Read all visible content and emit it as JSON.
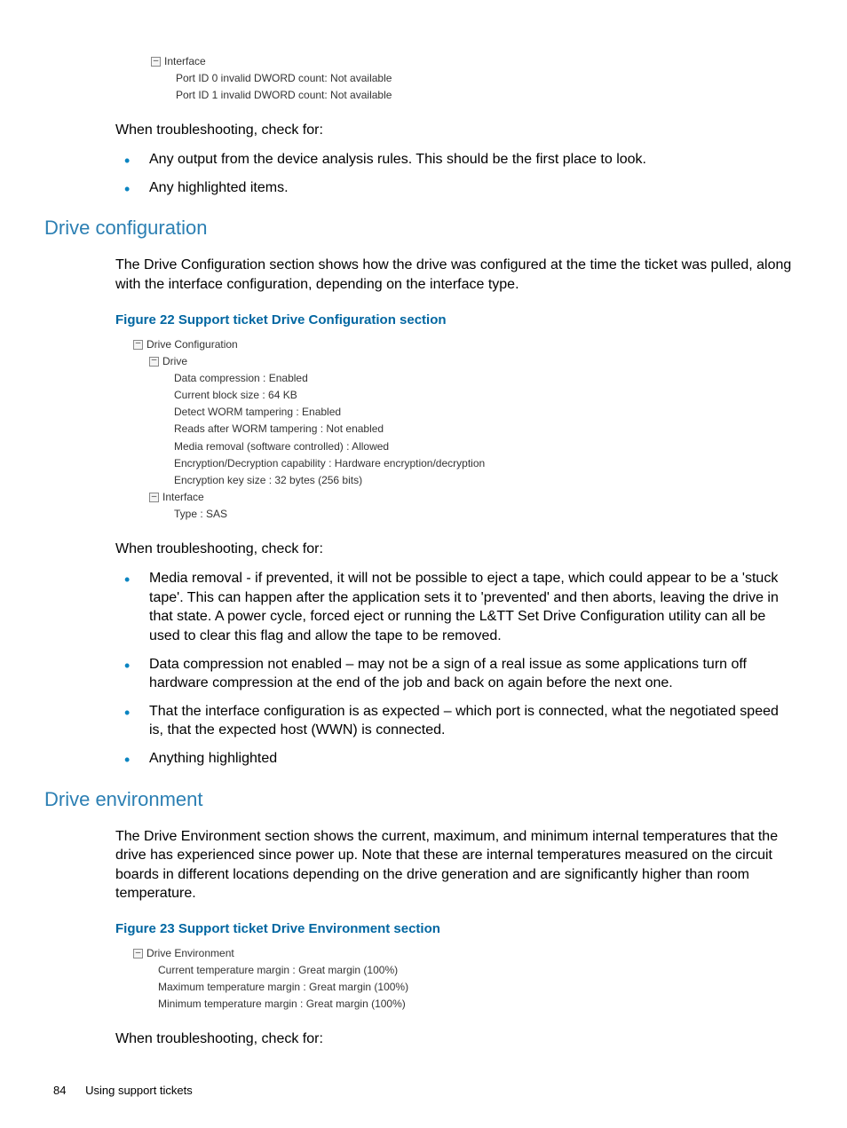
{
  "tree1": {
    "node": "Interface",
    "lines": [
      "Port ID 0 invalid DWORD count: Not available",
      "Port ID 1 invalid DWORD count: Not available"
    ]
  },
  "para1": "When troubleshooting, check for:",
  "bullets1": [
    "Any output from the device analysis rules. This should be the first place to look.",
    "Any highlighted items."
  ],
  "section1": {
    "title": "Drive configuration",
    "para": "The Drive Configuration section shows how the drive was configured at the time the ticket was pulled, along with the interface configuration, depending on the interface type.",
    "fig_caption": "Figure 22 Support ticket Drive Configuration section",
    "tree": {
      "root": "Drive Configuration",
      "drive_node": "Drive",
      "drive_leaves": [
        "Data compression : Enabled",
        "Current block size : 64 KB",
        "Detect WORM tampering : Enabled",
        "Reads after WORM tampering : Not enabled",
        "Media removal (software controlled) : Allowed",
        "Encryption/Decryption capability : Hardware encryption/decryption",
        "Encryption key size : 32 bytes (256 bits)"
      ],
      "iface_node": "Interface",
      "iface_leaves": [
        "Type : SAS"
      ]
    },
    "para2": "When troubleshooting, check for:",
    "bullets": [
      "Media removal - if prevented, it will not be possible to eject a tape, which could appear to be a 'stuck tape'. This can happen after the application sets it to 'prevented' and then aborts, leaving the drive in that state. A power cycle, forced eject or running the L&TT Set Drive Configuration utility can all be used to clear this flag and allow the tape to be removed.",
      "Data compression not enabled – may not be a sign of a real issue as some applications turn off hardware compression at the end of the job and back on again before the next one.",
      "That the interface configuration is as expected – which port is connected, what the negotiated speed is, that the expected host (WWN) is connected.",
      "Anything highlighted"
    ]
  },
  "section2": {
    "title": "Drive environment",
    "para": "The Drive Environment section shows the current, maximum, and minimum internal temperatures that the drive has experienced since power up. Note that these are internal temperatures measured on the circuit boards in different locations depending on the drive generation and are significantly higher than room temperature.",
    "fig_caption": "Figure 23 Support ticket Drive Environment section",
    "tree": {
      "root": "Drive Environment",
      "leaves": [
        "Current temperature margin : Great margin (100%)",
        "Maximum temperature margin : Great margin (100%)",
        "Minimum temperature margin : Great margin (100%)"
      ]
    },
    "para2": "When troubleshooting, check for:"
  },
  "footer": {
    "page": "84",
    "title": "Using support tickets"
  }
}
